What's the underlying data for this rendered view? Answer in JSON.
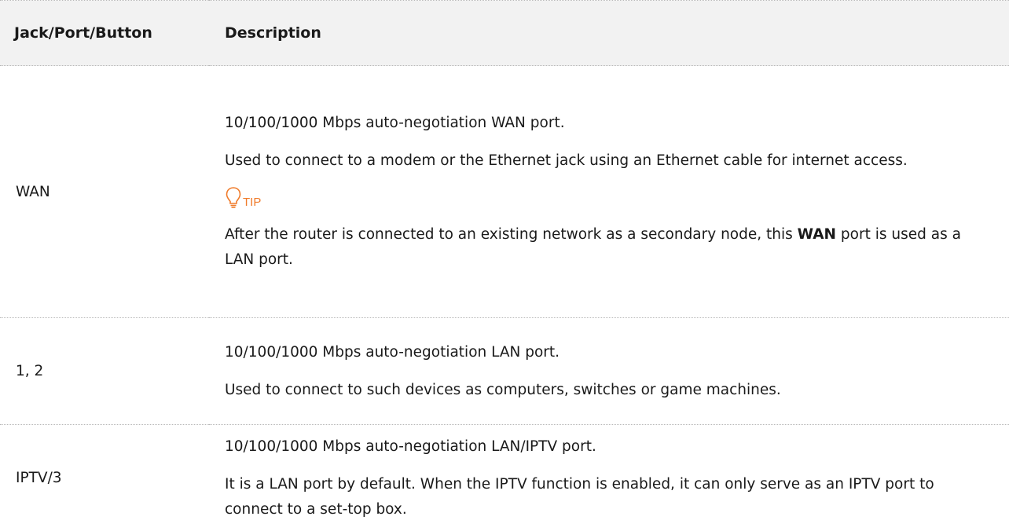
{
  "table": {
    "headers": {
      "port": "Jack/Port/Button",
      "description": "Description"
    },
    "rows": [
      {
        "port": "WAN",
        "lines": [
          "10/100/1000 Mbps auto-negotiation WAN port.",
          "Used to connect to a modem or the Ethernet jack using an Ethernet cable for internet access."
        ],
        "tip": {
          "label": "TIP",
          "icon": "lightbulb-icon",
          "text_before": "After the router is connected to an existing network as a secondary node, this ",
          "text_bold": "WAN",
          "text_after": " port is used as a LAN port."
        }
      },
      {
        "port": "1, 2",
        "lines": [
          "10/100/1000 Mbps auto-negotiation LAN port.",
          "Used to connect to such devices as computers, switches or game machines."
        ]
      },
      {
        "port": "IPTV/3",
        "lines": [
          "10/100/1000 Mbps auto-negotiation LAN/IPTV port.",
          "It is a LAN port by default. When the IPTV function is enabled, it can only serve as an IPTV port to connect to a set-top box."
        ]
      }
    ]
  },
  "colors": {
    "header_bg": "#f2f2f2",
    "tip_accent": "#f07b2a",
    "text": "#1a1a1a"
  }
}
